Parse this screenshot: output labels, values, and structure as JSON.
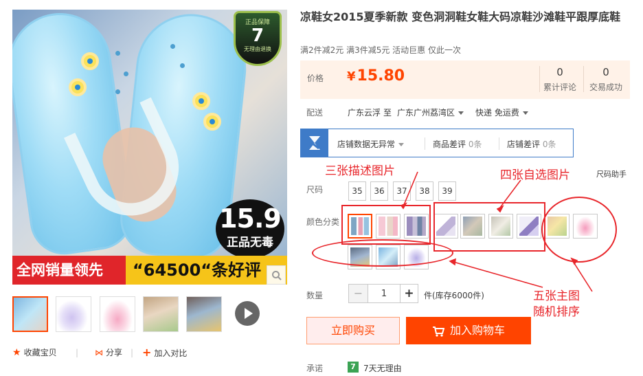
{
  "gallery": {
    "guarantee_badge": {
      "line1": "正品保障",
      "line2": "7",
      "line3": "无理由退换"
    },
    "price_badge": {
      "big": "15.9",
      "small": "正品无毒"
    },
    "banner": {
      "left": "全网销量领先",
      "right": "“64500“条好评"
    },
    "thumbnails": [
      "thumb-1",
      "thumb-2",
      "thumb-3",
      "thumb-4",
      "thumb-5"
    ],
    "actions": {
      "favorite": "收藏宝贝",
      "share": "分享",
      "compare": "加入对比"
    }
  },
  "product": {
    "title": "凉鞋女2015夏季新款 变色洞洞鞋女鞋大码凉鞋沙滩鞋平跟厚底鞋",
    "promo": "满2件减2元 满3件减5元 活动巨惠 仅此一次",
    "price_label": "价格",
    "price_symbol": "¥",
    "price": "15.80",
    "reviews_count": "0",
    "reviews_label": "累计评论",
    "sales_count": "0",
    "sales_label": "交易成功"
  },
  "delivery": {
    "label": "配送",
    "from": "广东云浮",
    "to_word": "至",
    "to": "广东广州荔湾区",
    "shipping": "快递 免运费"
  },
  "shop": {
    "status": "店铺数据无异常",
    "goods_diff_label": "商品差评",
    "goods_diff_value": "0条",
    "shop_diff_label": "店铺差评",
    "shop_diff_value": "0条"
  },
  "size": {
    "label": "尺码",
    "helper": "尺码助手",
    "options": [
      "35",
      "36",
      "37",
      "38",
      "39"
    ]
  },
  "color": {
    "label": "颜色分类"
  },
  "annotations": {
    "three_desc": "三张描述图片",
    "four_custom": "四张自选图片",
    "five_main_line1": "五张主图",
    "five_main_line2": "随机排序"
  },
  "quantity": {
    "label": "数量",
    "minus": "−",
    "value": "1",
    "plus": "+",
    "stock": "件(库存6000件)"
  },
  "buttons": {
    "buy_now": "立即购买",
    "add_cart": "加入购物车"
  },
  "promise": {
    "label": "承诺",
    "icon_text": "7",
    "text": "7天无理由"
  },
  "colors": {
    "accent": "#ff4400",
    "annotation_red": "#e8262b",
    "shop_blue": "#3e7bc8",
    "price_bg": "#fff2e8"
  }
}
